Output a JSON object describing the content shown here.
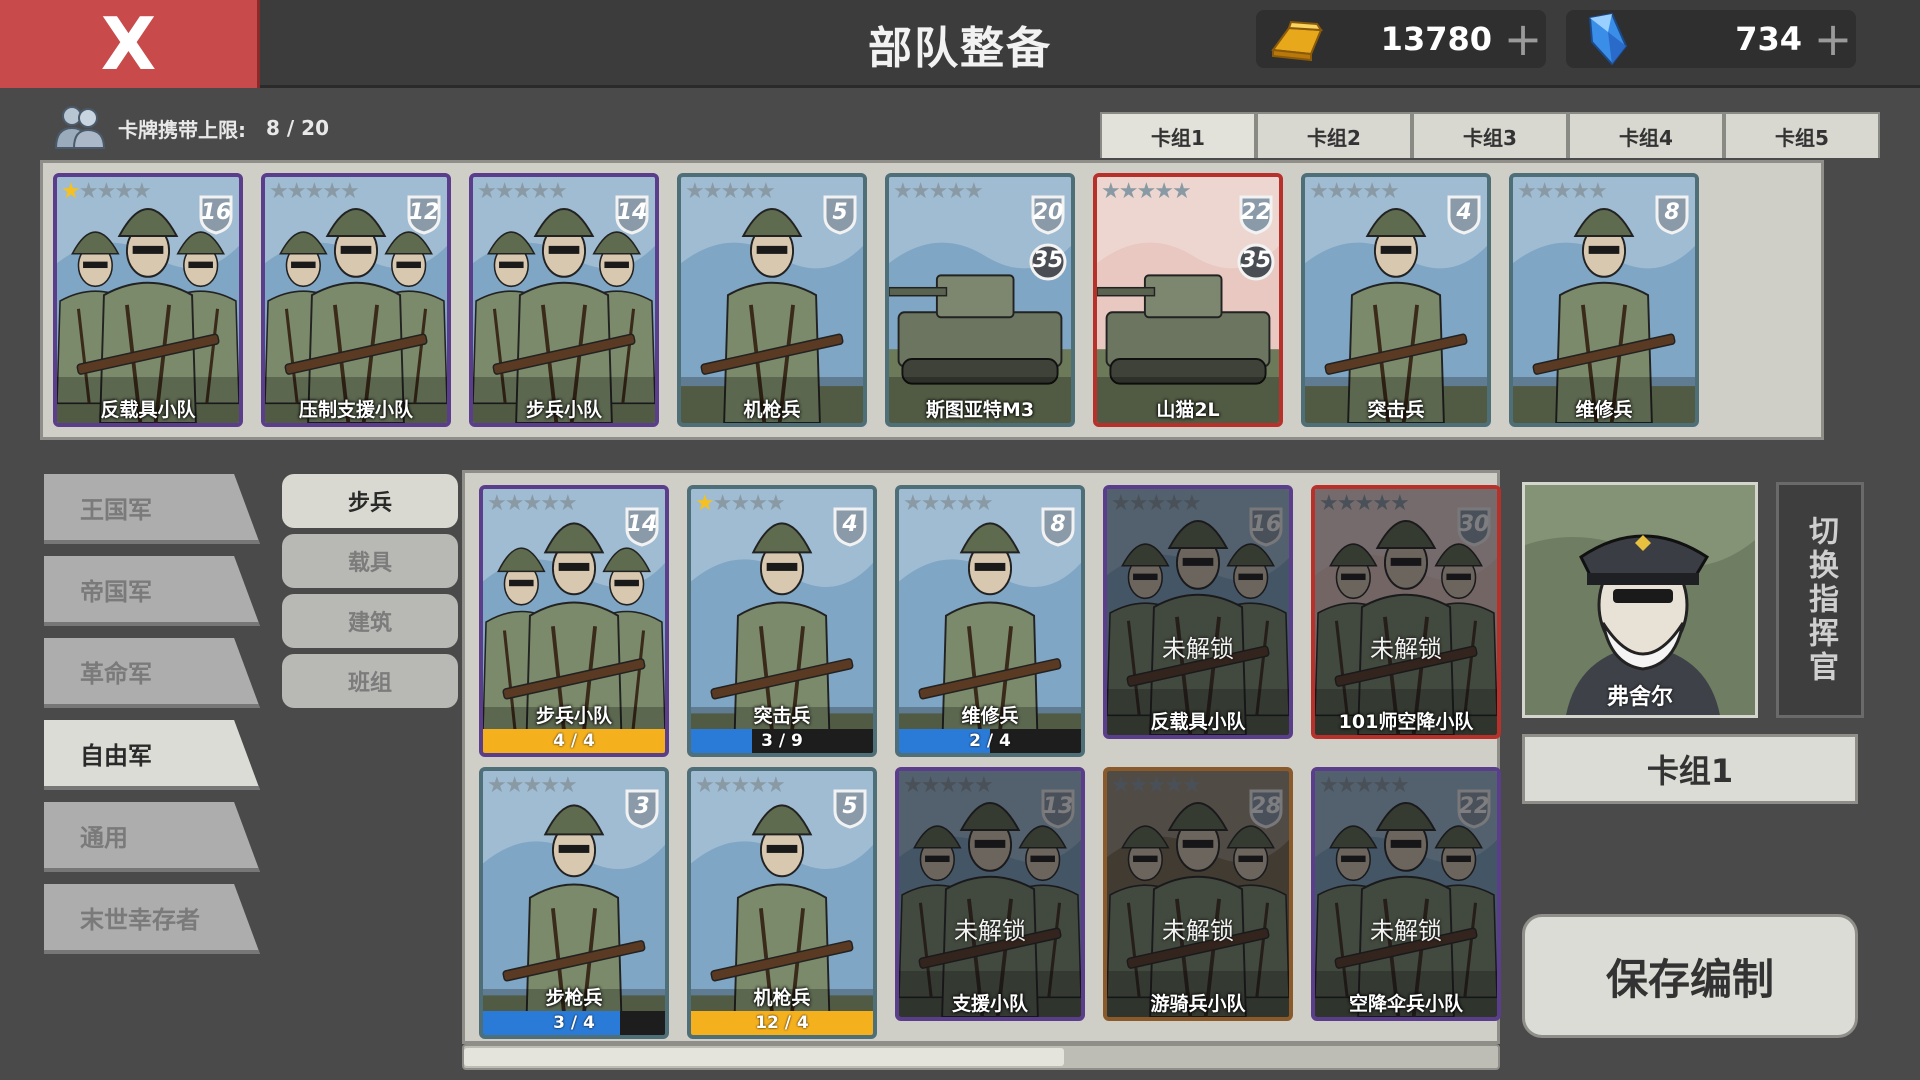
{
  "header": {
    "close_label": "X",
    "title": "部队整备",
    "gold": {
      "icon": "gold-bar-icon",
      "value": "13780",
      "plus": "+"
    },
    "gems": {
      "icon": "blue-crystal-icon",
      "value": "734",
      "plus": "+"
    }
  },
  "deck_limit": {
    "icon": "soldiers-icon",
    "label": "卡牌携带上限:",
    "value": "8 / 20"
  },
  "deck_tabs": [
    "卡组1",
    "卡组2",
    "卡组3",
    "卡组4",
    "卡组5"
  ],
  "deck_cards": [
    {
      "name": "反载具小队",
      "cost": "16",
      "stars": 1,
      "frame": "purple",
      "art": "infantry-squad"
    },
    {
      "name": "压制支援小队",
      "cost": "12",
      "stars": 0,
      "frame": "purple",
      "art": "infantry-squad"
    },
    {
      "name": "步兵小队",
      "cost": "14",
      "stars": 0,
      "frame": "purple",
      "art": "infantry-squad"
    },
    {
      "name": "机枪兵",
      "cost": "5",
      "stars": 0,
      "frame": "teal",
      "art": "soldier"
    },
    {
      "name": "斯图亚特M3",
      "cost": "20",
      "cost2": "35",
      "stars": 0,
      "frame": "teal",
      "art": "tank"
    },
    {
      "name": "山猫2L",
      "cost": "22",
      "cost2": "35",
      "stars": 0,
      "frame": "red",
      "art": "tank"
    },
    {
      "name": "突击兵",
      "cost": "4",
      "stars": 0,
      "frame": "teal",
      "art": "soldier"
    },
    {
      "name": "维修兵",
      "cost": "8",
      "stars": 0,
      "frame": "teal",
      "art": "soldier"
    }
  ],
  "factions": [
    "王国军",
    "帝国军",
    "革命军",
    "自由军",
    "通用",
    "末世幸存者"
  ],
  "active_faction": "自由军",
  "categories": [
    "步兵",
    "载具",
    "建筑",
    "班组"
  ],
  "active_category": "步兵",
  "collection_cards": [
    {
      "name": "步兵小队",
      "cost": "14",
      "stars": 0,
      "frame": "purple",
      "art": "infantry-squad",
      "progress": "4 / 4",
      "progress_value": 1.0,
      "progress_color": "#f5b01e"
    },
    {
      "name": "突击兵",
      "cost": "4",
      "stars": 1,
      "frame": "teal",
      "art": "soldier",
      "progress": "3 / 9",
      "progress_value": 0.3333,
      "progress_color": "#2a7ad8"
    },
    {
      "name": "维修兵",
      "cost": "8",
      "stars": 0,
      "frame": "teal",
      "art": "soldier",
      "progress": "2 / 4",
      "progress_value": 0.5,
      "progress_color": "#2a7ad8"
    },
    {
      "name": "反载具小队",
      "cost": "16",
      "stars": 0,
      "frame": "purple",
      "art": "infantry-squad",
      "locked": "未解锁"
    },
    {
      "name": "101师空降小队",
      "cost": "30",
      "stars": 0,
      "frame": "red",
      "art": "infantry-squad",
      "locked": "未解锁"
    },
    {
      "name": "步枪兵",
      "cost": "3",
      "stars": 0,
      "frame": "teal",
      "art": "soldier",
      "progress": "3 / 4",
      "progress_value": 0.75,
      "progress_color": "#2a7ad8"
    },
    {
      "name": "机枪兵",
      "cost": "5",
      "stars": 0,
      "frame": "teal",
      "art": "soldier",
      "progress": "12 / 4",
      "progress_value": 1.0,
      "progress_color": "#f5b01e"
    },
    {
      "name": "支援小队",
      "cost": "13",
      "stars": 0,
      "frame": "purple",
      "art": "infantry-squad",
      "locked": "未解锁"
    },
    {
      "name": "游骑兵小队",
      "cost": "28",
      "stars": 0,
      "frame": "bronze",
      "art": "infantry-squad",
      "locked": "未解锁"
    },
    {
      "name": "空降伞兵小队",
      "cost": "22",
      "stars": 0,
      "frame": "purple",
      "art": "infantry-squad",
      "locked": "未解锁"
    }
  ],
  "scrollbar": {
    "position": 0.0,
    "visible_fraction": 0.58
  },
  "commander": {
    "name": "弗舍尔",
    "switch_label": "切换指挥官"
  },
  "current_deck": "卡组1",
  "save_label": "保存编制"
}
